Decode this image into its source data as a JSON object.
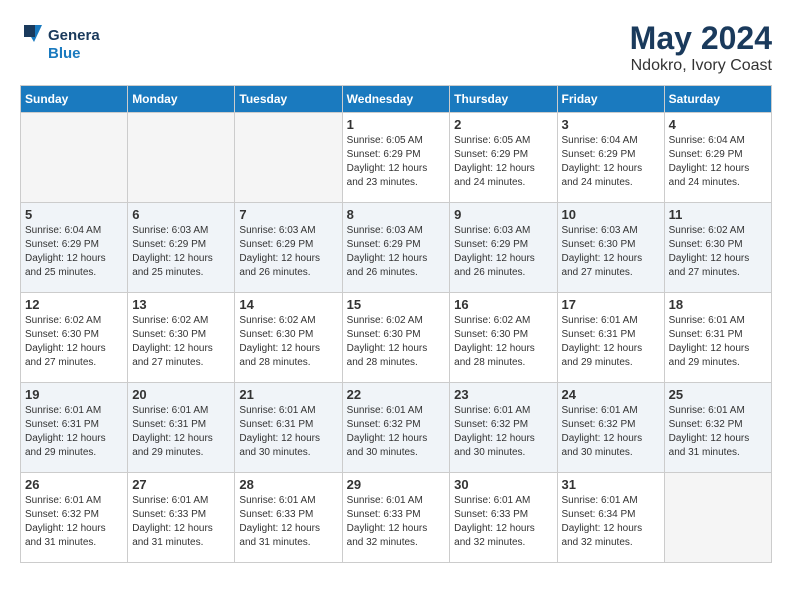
{
  "header": {
    "logo_general": "General",
    "logo_blue": "Blue",
    "month_year": "May 2024",
    "location": "Ndokro, Ivory Coast"
  },
  "days_of_week": [
    "Sunday",
    "Monday",
    "Tuesday",
    "Wednesday",
    "Thursday",
    "Friday",
    "Saturday"
  ],
  "weeks": [
    {
      "alt": false,
      "days": [
        {
          "num": "",
          "info": ""
        },
        {
          "num": "",
          "info": ""
        },
        {
          "num": "",
          "info": ""
        },
        {
          "num": "1",
          "info": "Sunrise: 6:05 AM\nSunset: 6:29 PM\nDaylight: 12 hours\nand 23 minutes."
        },
        {
          "num": "2",
          "info": "Sunrise: 6:05 AM\nSunset: 6:29 PM\nDaylight: 12 hours\nand 24 minutes."
        },
        {
          "num": "3",
          "info": "Sunrise: 6:04 AM\nSunset: 6:29 PM\nDaylight: 12 hours\nand 24 minutes."
        },
        {
          "num": "4",
          "info": "Sunrise: 6:04 AM\nSunset: 6:29 PM\nDaylight: 12 hours\nand 24 minutes."
        }
      ]
    },
    {
      "alt": true,
      "days": [
        {
          "num": "5",
          "info": "Sunrise: 6:04 AM\nSunset: 6:29 PM\nDaylight: 12 hours\nand 25 minutes."
        },
        {
          "num": "6",
          "info": "Sunrise: 6:03 AM\nSunset: 6:29 PM\nDaylight: 12 hours\nand 25 minutes."
        },
        {
          "num": "7",
          "info": "Sunrise: 6:03 AM\nSunset: 6:29 PM\nDaylight: 12 hours\nand 26 minutes."
        },
        {
          "num": "8",
          "info": "Sunrise: 6:03 AM\nSunset: 6:29 PM\nDaylight: 12 hours\nand 26 minutes."
        },
        {
          "num": "9",
          "info": "Sunrise: 6:03 AM\nSunset: 6:29 PM\nDaylight: 12 hours\nand 26 minutes."
        },
        {
          "num": "10",
          "info": "Sunrise: 6:03 AM\nSunset: 6:30 PM\nDaylight: 12 hours\nand 27 minutes."
        },
        {
          "num": "11",
          "info": "Sunrise: 6:02 AM\nSunset: 6:30 PM\nDaylight: 12 hours\nand 27 minutes."
        }
      ]
    },
    {
      "alt": false,
      "days": [
        {
          "num": "12",
          "info": "Sunrise: 6:02 AM\nSunset: 6:30 PM\nDaylight: 12 hours\nand 27 minutes."
        },
        {
          "num": "13",
          "info": "Sunrise: 6:02 AM\nSunset: 6:30 PM\nDaylight: 12 hours\nand 27 minutes."
        },
        {
          "num": "14",
          "info": "Sunrise: 6:02 AM\nSunset: 6:30 PM\nDaylight: 12 hours\nand 28 minutes."
        },
        {
          "num": "15",
          "info": "Sunrise: 6:02 AM\nSunset: 6:30 PM\nDaylight: 12 hours\nand 28 minutes."
        },
        {
          "num": "16",
          "info": "Sunrise: 6:02 AM\nSunset: 6:30 PM\nDaylight: 12 hours\nand 28 minutes."
        },
        {
          "num": "17",
          "info": "Sunrise: 6:01 AM\nSunset: 6:31 PM\nDaylight: 12 hours\nand 29 minutes."
        },
        {
          "num": "18",
          "info": "Sunrise: 6:01 AM\nSunset: 6:31 PM\nDaylight: 12 hours\nand 29 minutes."
        }
      ]
    },
    {
      "alt": true,
      "days": [
        {
          "num": "19",
          "info": "Sunrise: 6:01 AM\nSunset: 6:31 PM\nDaylight: 12 hours\nand 29 minutes."
        },
        {
          "num": "20",
          "info": "Sunrise: 6:01 AM\nSunset: 6:31 PM\nDaylight: 12 hours\nand 29 minutes."
        },
        {
          "num": "21",
          "info": "Sunrise: 6:01 AM\nSunset: 6:31 PM\nDaylight: 12 hours\nand 30 minutes."
        },
        {
          "num": "22",
          "info": "Sunrise: 6:01 AM\nSunset: 6:32 PM\nDaylight: 12 hours\nand 30 minutes."
        },
        {
          "num": "23",
          "info": "Sunrise: 6:01 AM\nSunset: 6:32 PM\nDaylight: 12 hours\nand 30 minutes."
        },
        {
          "num": "24",
          "info": "Sunrise: 6:01 AM\nSunset: 6:32 PM\nDaylight: 12 hours\nand 30 minutes."
        },
        {
          "num": "25",
          "info": "Sunrise: 6:01 AM\nSunset: 6:32 PM\nDaylight: 12 hours\nand 31 minutes."
        }
      ]
    },
    {
      "alt": false,
      "days": [
        {
          "num": "26",
          "info": "Sunrise: 6:01 AM\nSunset: 6:32 PM\nDaylight: 12 hours\nand 31 minutes."
        },
        {
          "num": "27",
          "info": "Sunrise: 6:01 AM\nSunset: 6:33 PM\nDaylight: 12 hours\nand 31 minutes."
        },
        {
          "num": "28",
          "info": "Sunrise: 6:01 AM\nSunset: 6:33 PM\nDaylight: 12 hours\nand 31 minutes."
        },
        {
          "num": "29",
          "info": "Sunrise: 6:01 AM\nSunset: 6:33 PM\nDaylight: 12 hours\nand 32 minutes."
        },
        {
          "num": "30",
          "info": "Sunrise: 6:01 AM\nSunset: 6:33 PM\nDaylight: 12 hours\nand 32 minutes."
        },
        {
          "num": "31",
          "info": "Sunrise: 6:01 AM\nSunset: 6:34 PM\nDaylight: 12 hours\nand 32 minutes."
        },
        {
          "num": "",
          "info": ""
        }
      ]
    }
  ]
}
